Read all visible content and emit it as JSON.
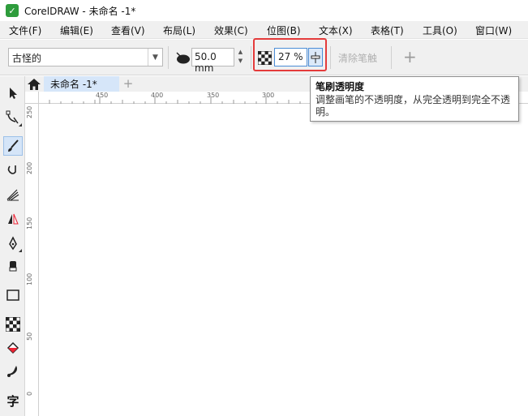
{
  "window": {
    "title": "CorelDRAW - 未命名 -1*",
    "logo_char": "✓"
  },
  "menu": [
    {
      "label": "文件(F)"
    },
    {
      "label": "编辑(E)"
    },
    {
      "label": "查看(V)"
    },
    {
      "label": "布局(L)"
    },
    {
      "label": "效果(C)"
    },
    {
      "label": "位图(B)"
    },
    {
      "label": "文本(X)"
    },
    {
      "label": "表格(T)"
    },
    {
      "label": "工具(O)"
    },
    {
      "label": "窗口(W)"
    }
  ],
  "propbar": {
    "stroke_style": "古怪的",
    "brush_size": "50.0 mm",
    "brush_opacity": "27 %",
    "clear_stroke_label": "清除笔触",
    "add_label": "+"
  },
  "tooltip": {
    "title": "笔刷透明度",
    "body": "调整画笔的不透明度，从完全透明到完全不透明。"
  },
  "tabs": {
    "document_tab": "未命名 -1*",
    "add_tab": "+"
  },
  "ruler_top_labels": [
    "450",
    "400",
    "350",
    "300"
  ],
  "ruler_left_labels": [
    "250",
    "200",
    "150",
    "100",
    "50",
    "0"
  ],
  "toolbox": {
    "tools": [
      {
        "name": "pick-tool-icon"
      },
      {
        "name": "shape-tool-icon"
      },
      {
        "name": "artistic-media-tool-icon"
      },
      {
        "name": "freehand-tool-icon"
      },
      {
        "name": "effects-tool-icon"
      },
      {
        "name": "mirror-tool-icon"
      },
      {
        "name": "pen-tool-icon"
      },
      {
        "name": "eraser-tool-icon"
      },
      {
        "name": "rectangle-tool-icon"
      },
      {
        "name": "transparency-tool-icon"
      },
      {
        "name": "fill-tool-icon"
      },
      {
        "name": "smart-fill-tool-icon"
      },
      {
        "name": "text-tool-icon"
      }
    ],
    "text_tool_char": "字"
  },
  "colors": {
    "highlight": "#e43b3b",
    "tab_active": "#d6e6f9",
    "tool_active": "#d5e5f8"
  }
}
